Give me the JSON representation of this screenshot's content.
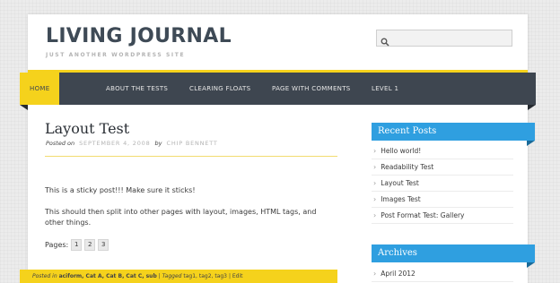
{
  "site": {
    "title": "LIVING JOURNAL",
    "description": "JUST ANOTHER WORDPRESS SITE"
  },
  "search": {
    "placeholder": "",
    "value": "",
    "icon": "search-icon"
  },
  "nav": {
    "items": [
      {
        "label": "HOME",
        "active": true
      },
      {
        "label": "ABOUT THE TESTS",
        "active": false
      },
      {
        "label": "CLEARING FLOATS",
        "active": false
      },
      {
        "label": "PAGE WITH COMMENTS",
        "active": false
      },
      {
        "label": "LEVEL 1",
        "active": false
      }
    ]
  },
  "post": {
    "title": "Layout Test",
    "posted_on_label": "Posted on",
    "date": "SEPTEMBER 4, 2008",
    "by_label": "by",
    "author": "CHIP BENNETT",
    "paragraphs": [
      "This is a sticky post!!! Make sure it sticks!",
      "This should then split into other pages with layout, images, HTML tags, and other things."
    ],
    "pages_label": "Pages:",
    "pages": [
      "1",
      "2",
      "3"
    ],
    "footer": {
      "posted_in_label": "Posted in",
      "categories": "aciform, Cat A, Cat B, Cat C, sub",
      "sep": "|",
      "tagged_label": "Tagged",
      "tags": "tag1, tag2, tag3",
      "edit": "Edit"
    }
  },
  "sidebar": {
    "recent_posts": {
      "title": "Recent Posts",
      "items": [
        "Hello world!",
        "Readability Test",
        "Layout Test",
        "Images Test",
        "Post Format Test: Gallery"
      ]
    },
    "archives": {
      "title": "Archives",
      "items": [
        "April 2012"
      ]
    }
  },
  "colors": {
    "accent_yellow": "#f5d21c",
    "nav_dark": "#3e4650",
    "widget_blue": "#2f9fe0"
  }
}
